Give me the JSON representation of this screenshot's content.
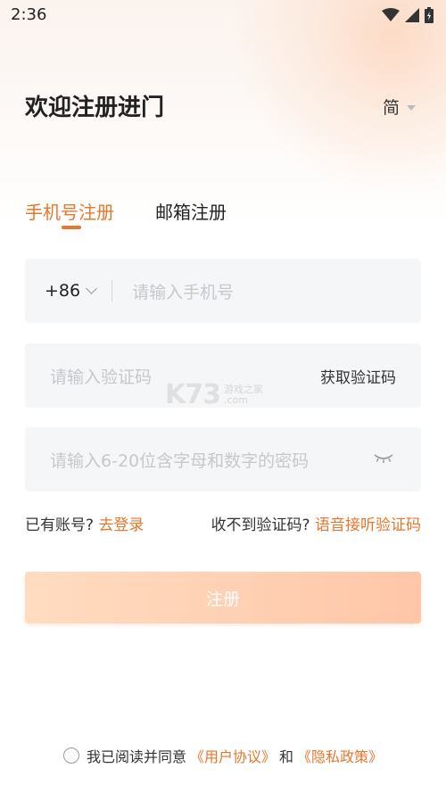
{
  "status_bar": {
    "time": "2:36"
  },
  "header": {
    "title": "欢迎注册进门",
    "language": "简"
  },
  "tabs": [
    {
      "label": "手机号注册",
      "active": true
    },
    {
      "label": "邮箱注册",
      "active": false
    }
  ],
  "phone_field": {
    "country_code": "+86",
    "placeholder": "请输入手机号"
  },
  "code_field": {
    "placeholder": "请输入验证码",
    "get_code_label": "获取验证码"
  },
  "password_field": {
    "placeholder": "请输入6-20位含字母和数字的密码"
  },
  "links": {
    "have_account": "已有账号?",
    "login": "去登录",
    "no_code": "收不到验证码?",
    "voice_code": "语音接听验证码"
  },
  "submit_label": "注册",
  "agreement": {
    "prefix": "我已阅读并同意",
    "user_agreement": "《用户协议》",
    "and": "和",
    "privacy_policy": "《隐私政策》"
  },
  "watermark": {
    "logo": "K73",
    "cn": "游戏之家",
    "domain": ".com"
  },
  "colors": {
    "accent": "#e8762b",
    "field_bg": "#f5f6f8",
    "button_from": "#ffdcc0",
    "button_to": "#ffc6a8"
  },
  "icons": [
    "wifi-icon",
    "signal-icon",
    "battery-icon",
    "caret-down-icon",
    "chevron-down-icon",
    "eye-closed-icon",
    "radio-unchecked-icon"
  ]
}
